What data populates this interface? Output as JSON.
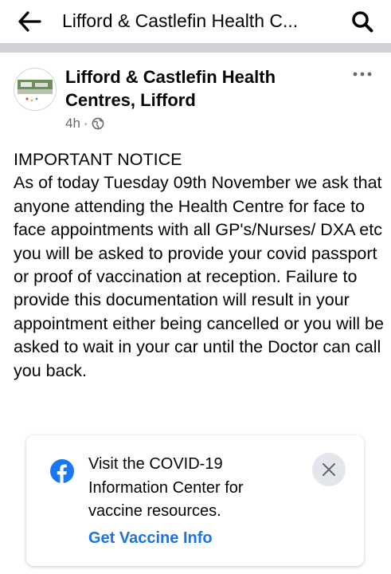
{
  "header": {
    "title": "Lifford & Castlefin Health C...",
    "back_icon": "arrow-left-icon",
    "search_icon": "search-icon"
  },
  "post": {
    "author_name": "Lifford & Castlefin Health Centres, Lifford",
    "timestamp": "4h",
    "separator": "·",
    "audience_icon": "globe-icon",
    "more_icon": "more-horizontal-icon",
    "heading": "IMPORTANT NOTICE",
    "body": "As of today Tuesday 09th November we ask that anyone attending the Health Centre for face to face appointments with all GP's/Nurses/ DXA etc you will be asked to provide your covid passport or proof of vaccination at reception. Failure to provide this documentation will result in your appointment either being cancelled or you will be asked to wait in your car until the Doctor can call you back."
  },
  "covid_card": {
    "icon": "facebook-icon",
    "message": "Visit the COVID-19 Information Center for vaccine resources.",
    "link_label": "Get Vaccine Info",
    "close_icon": "close-icon"
  },
  "colors": {
    "link_blue": "#1b74e4",
    "facebook_blue": "#1877f2",
    "secondary_text": "#65676b",
    "divider_gray": "#d0d2d5"
  }
}
